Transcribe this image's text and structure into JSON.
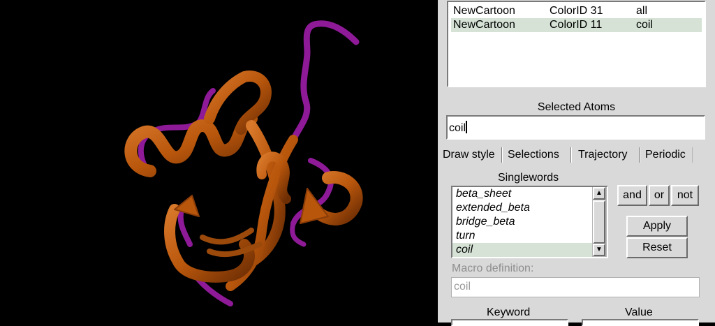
{
  "viewport": {
    "background": "#000000",
    "colors": {
      "helix_sheet": "#b8560c",
      "coil": "#8e1a98"
    }
  },
  "representations": {
    "rows": [
      {
        "rep": "NewCartoon",
        "color": "ColorID 31",
        "selection": "all",
        "selected": false
      },
      {
        "rep": "NewCartoon",
        "color": "ColorID 11",
        "selection": "coil",
        "selected": true
      }
    ]
  },
  "selected_atoms": {
    "label": "Selected Atoms",
    "value": "coil"
  },
  "tabs": [
    "Draw style",
    "Selections",
    "Trajectory",
    "Periodic"
  ],
  "active_tab": "Selections",
  "singlewords": {
    "label": "Singlewords",
    "items": [
      "beta_sheet",
      "extended_beta",
      "bridge_beta",
      "turn",
      "coil"
    ],
    "selected": "coil"
  },
  "operators": {
    "and": "and",
    "or": "or",
    "not": "not"
  },
  "actions": {
    "apply": "Apply",
    "reset": "Reset"
  },
  "macro": {
    "label": "Macro definition:",
    "value": "coil"
  },
  "keyword_value": {
    "keyword": "Keyword",
    "value": "Value"
  }
}
